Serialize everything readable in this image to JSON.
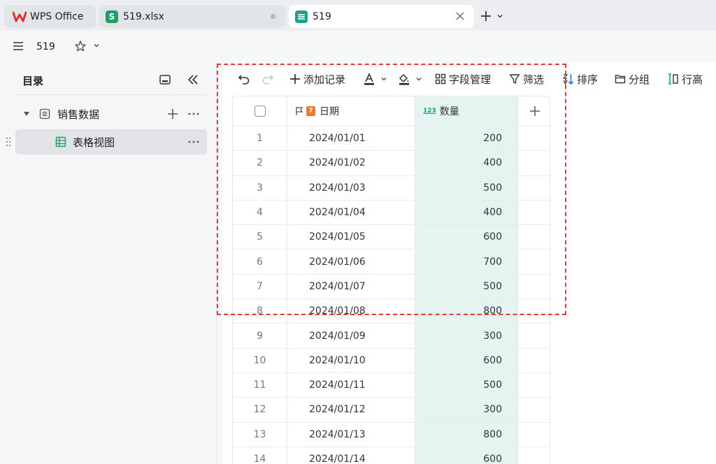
{
  "tabs": [
    {
      "label": "WPS Office"
    },
    {
      "label": "519.xlsx"
    },
    {
      "label": "519"
    }
  ],
  "doc": {
    "title": "519"
  },
  "sidebar": {
    "title": "目录",
    "node": {
      "label": "销售数据"
    },
    "view": {
      "label": "表格视图"
    }
  },
  "toolbar": {
    "add_record": "添加记录",
    "field_manage": "字段管理",
    "filter": "筛选",
    "sort": "排序",
    "group": "分组",
    "row_height": "行高"
  },
  "table": {
    "columns": [
      {
        "name": "日期",
        "type_icon": "date-field-icon"
      },
      {
        "name": "数量",
        "type_icon": "number-field-icon",
        "type_text": "123"
      }
    ],
    "rows": [
      {
        "n": "1",
        "date": "2024/01/01",
        "qty": "200"
      },
      {
        "n": "2",
        "date": "2024/01/02",
        "qty": "400"
      },
      {
        "n": "3",
        "date": "2024/01/03",
        "qty": "500"
      },
      {
        "n": "4",
        "date": "2024/01/04",
        "qty": "400"
      },
      {
        "n": "5",
        "date": "2024/01/05",
        "qty": "600"
      },
      {
        "n": "6",
        "date": "2024/01/06",
        "qty": "700"
      },
      {
        "n": "7",
        "date": "2024/01/07",
        "qty": "500"
      },
      {
        "n": "8",
        "date": "2024/01/08",
        "qty": "800"
      },
      {
        "n": "9",
        "date": "2024/01/09",
        "qty": "300"
      },
      {
        "n": "10",
        "date": "2024/01/10",
        "qty": "600"
      },
      {
        "n": "11",
        "date": "2024/01/11",
        "qty": "500"
      },
      {
        "n": "12",
        "date": "2024/01/12",
        "qty": "300"
      },
      {
        "n": "13",
        "date": "2024/01/13",
        "qty": "800"
      },
      {
        "n": "14",
        "date": "2024/01/14",
        "qty": "600"
      }
    ]
  },
  "colors": {
    "accent": "#16a37f",
    "highlight": "#e53935",
    "qty_column_bg": "#e4f4f1"
  }
}
